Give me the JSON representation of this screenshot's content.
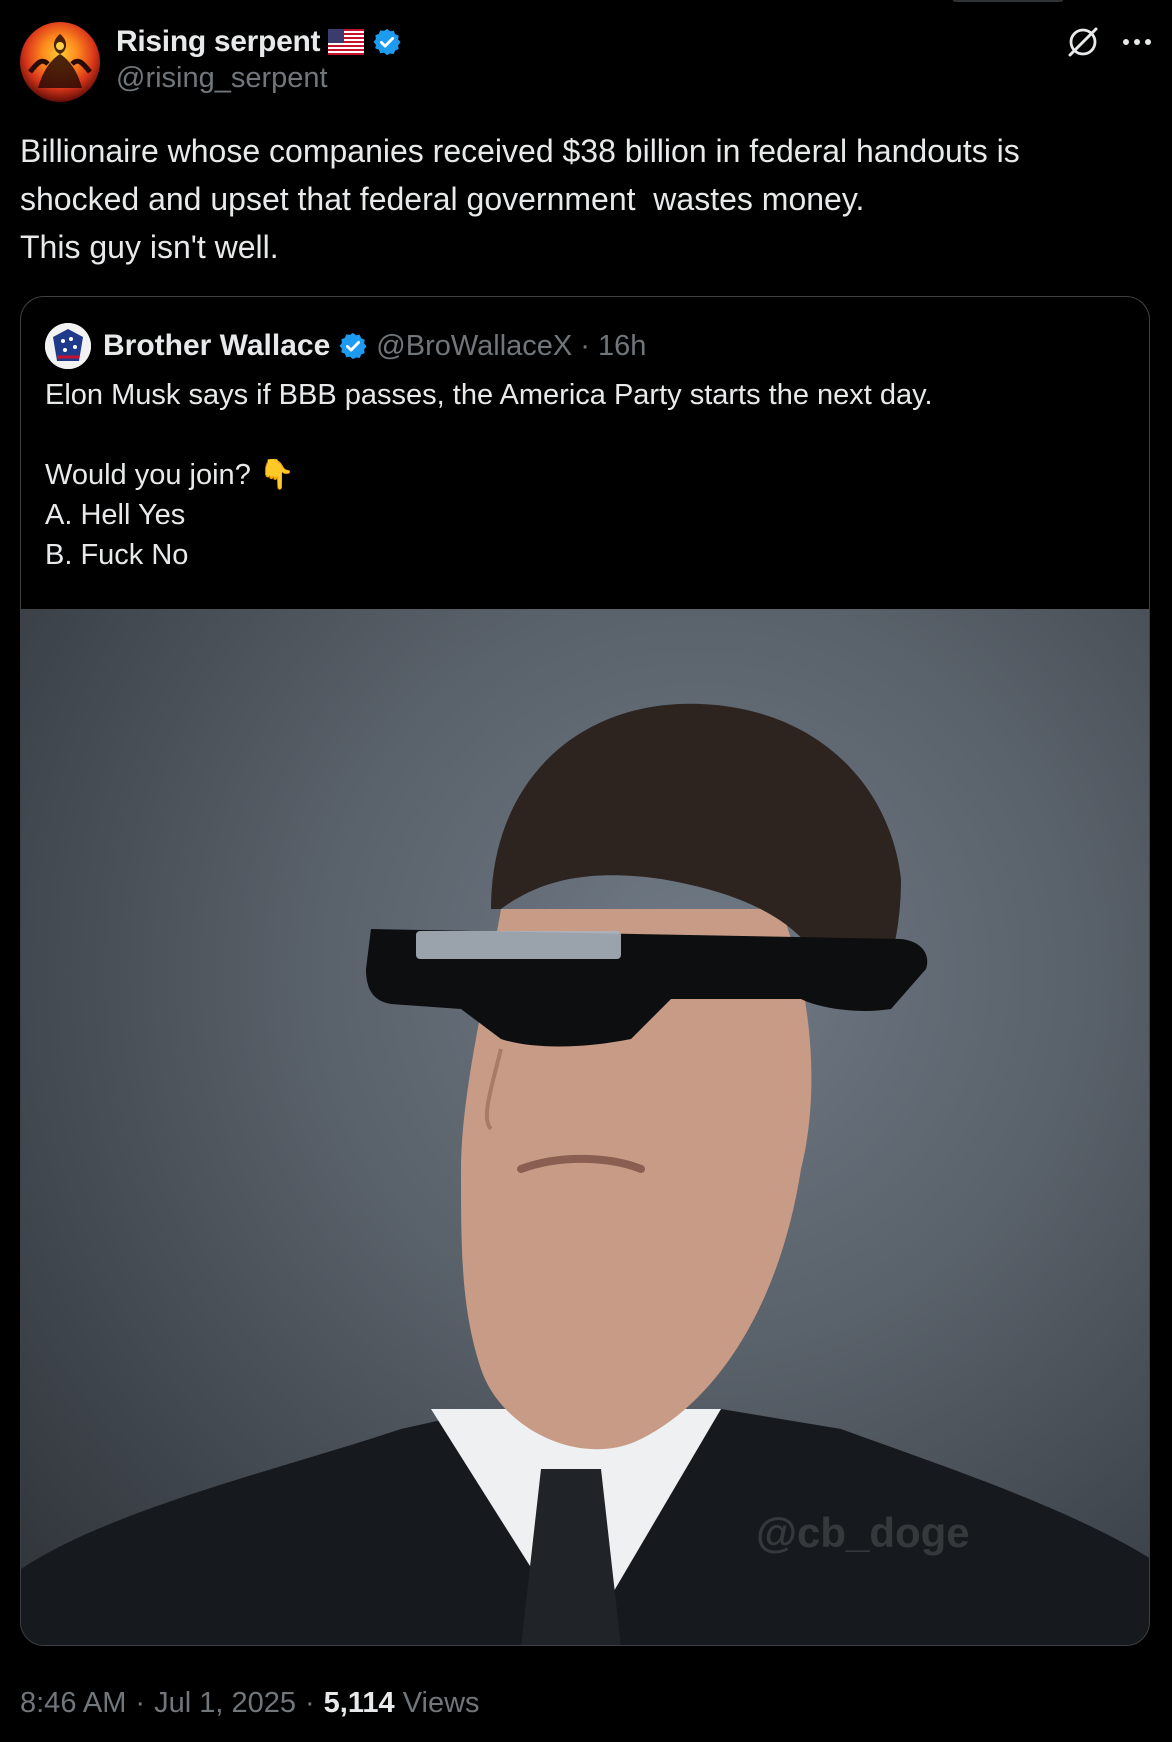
{
  "author": {
    "display_name": "Rising serpent",
    "handle": "@rising_serpent",
    "flag": "🇺🇸",
    "verified": true
  },
  "tweet": {
    "lines": [
      "Billionaire whose companies received $38 billion in federal handouts is",
      "shocked and upset that federal government  wastes money.",
      "This guy isn't well."
    ]
  },
  "quoted": {
    "display_name": "Brother Wallace",
    "handle": "@BroWallaceX",
    "separator": "·",
    "time": "16h",
    "verified": true,
    "lines": [
      "Elon Musk says if BBB passes, the America Party starts the next day.",
      "",
      "Would you join? 👇",
      "A. Hell Yes",
      "B. Fuck No"
    ],
    "image_watermark": "@cb_doge"
  },
  "footer": {
    "time": "8:46 AM",
    "sep1": "·",
    "date": "Jul 1, 2025",
    "sep2": "·",
    "views_count": "5,114",
    "views_label": "Views"
  },
  "colors": {
    "background": "#000000",
    "text_primary": "#e7e9ea",
    "text_secondary": "#71767b",
    "verified_blue": "#1d9bf0",
    "border": "#3e4144"
  },
  "icons": [
    "verified-badge-icon",
    "flag-icon",
    "grok-icon",
    "more-icon"
  ]
}
